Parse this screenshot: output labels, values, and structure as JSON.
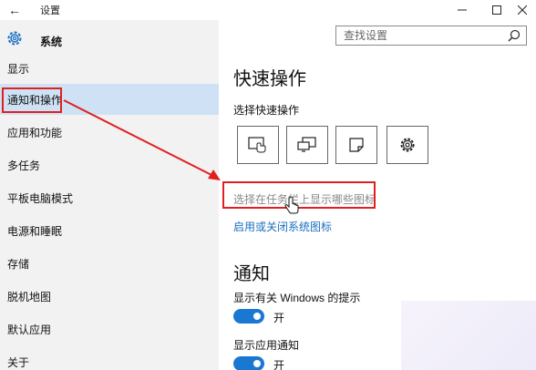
{
  "window": {
    "title": "设置",
    "back_icon": "back-arrow-icon",
    "min_icon": "minimize-icon",
    "max_icon": "maximize-icon",
    "close_icon": "close-icon"
  },
  "sidebar": {
    "title": "系统",
    "icon": "gear-icon",
    "items": [
      {
        "label": "显示"
      },
      {
        "label": "通知和操作",
        "active": true
      },
      {
        "label": "应用和功能"
      },
      {
        "label": "多任务"
      },
      {
        "label": "平板电脑模式"
      },
      {
        "label": "电源和睡眠"
      },
      {
        "label": "存储"
      },
      {
        "label": "脱机地图"
      },
      {
        "label": "默认应用"
      },
      {
        "label": "关于"
      }
    ]
  },
  "search": {
    "placeholder": "查找设置",
    "icon": "search-icon"
  },
  "main": {
    "quick_actions_heading": "快速操作",
    "quick_actions_sub": "选择快速操作",
    "quick_action_icons": [
      "tablet-mode-icon",
      "project-icon",
      "note-icon",
      "settings-gear-icon"
    ],
    "taskbar_icons_link": "选择在任务栏上显示哪些图标",
    "system_icons_link": "启用或关闭系统图标",
    "notifications_heading": "通知",
    "settings": [
      {
        "label": "显示有关 Windows 的提示",
        "toggle_label": "开",
        "on": true
      },
      {
        "label": "显示应用通知",
        "toggle_label": "开",
        "on": true
      }
    ]
  },
  "colors": {
    "accent": "#1a78d2",
    "link": "#1a6fc1",
    "highlight": "#e02020",
    "sidebar_bg": "#f2f2f2",
    "active_bg": "#cfe2f5"
  }
}
